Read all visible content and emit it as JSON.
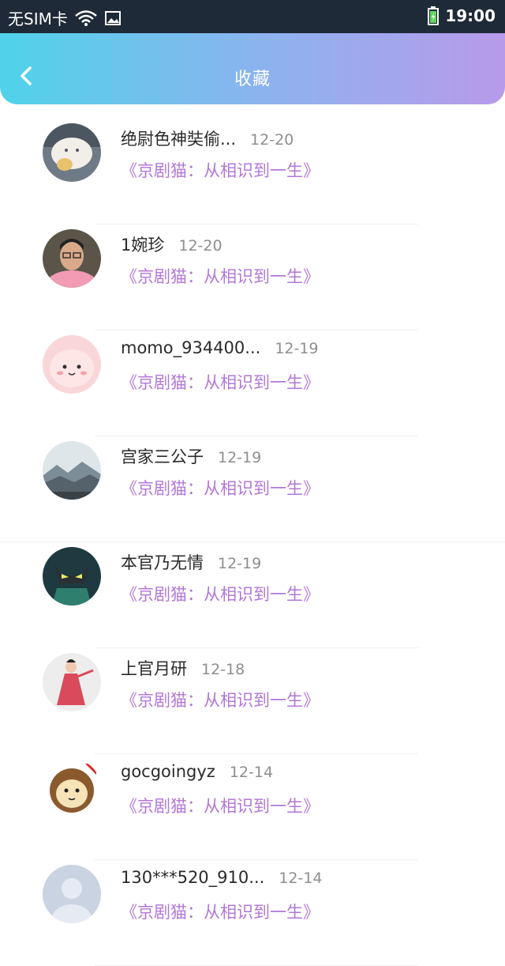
{
  "status_bar": {
    "carrier": "无SIM卡",
    "time": "19:00"
  },
  "header": {
    "title": "收藏"
  },
  "favorites": [
    {
      "name": "绝尉色神奘偷...",
      "date": "12-20",
      "desc": "《京剧猫：从相识到一生》"
    },
    {
      "name": "1婉珍",
      "date": "12-20",
      "desc": "《京剧猫：从相识到一生》"
    },
    {
      "name": "momo_934400...",
      "date": "12-19",
      "desc": "《京剧猫：从相识到一生》"
    },
    {
      "name": "宫家三公子",
      "date": "12-19",
      "desc": "《京剧猫：从相识到一生》"
    },
    {
      "name": "本官乃无情",
      "date": "12-19",
      "desc": "《京剧猫：从相识到一生》"
    },
    {
      "name": "上官月研",
      "date": "12-18",
      "desc": "《京剧猫：从相识到一生》"
    },
    {
      "name": "gocgoingyz",
      "date": "12-14",
      "desc": "《京剧猫：从相识到一生》"
    },
    {
      "name": "130***520_910...",
      "date": "12-14",
      "desc": "《京剧猫：从相识到一生》"
    }
  ],
  "colors": {
    "accent_text": "#b277d8",
    "header_gradient_start": "#4fd3ea",
    "header_gradient_end": "#b89aea"
  }
}
